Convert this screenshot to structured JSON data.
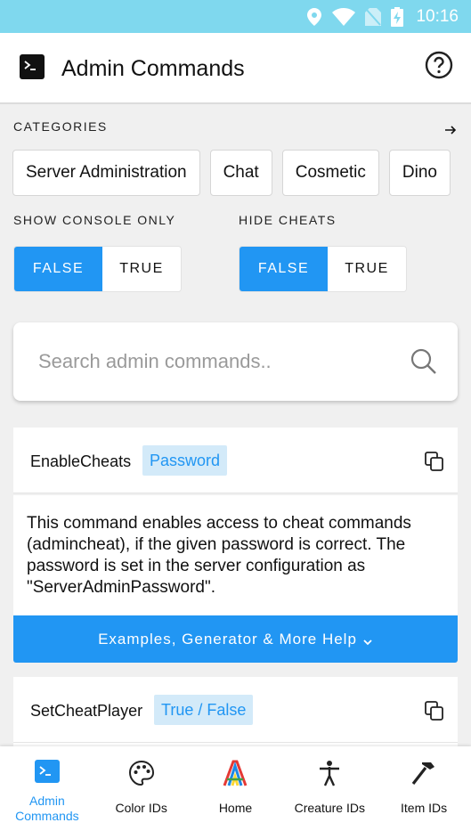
{
  "status_bar": {
    "time": "10:16"
  },
  "app_bar": {
    "title": "Admin Commands"
  },
  "categories": {
    "label": "CATEGORIES",
    "chips": [
      "Server Administration",
      "Chat",
      "Cosmetic",
      "Dino"
    ]
  },
  "show_console_only": {
    "label": "SHOW CONSOLE ONLY",
    "options": [
      "FALSE",
      "TRUE"
    ],
    "selected": "FALSE"
  },
  "hide_cheats": {
    "label": "HIDE CHEATS",
    "options": [
      "FALSE",
      "TRUE"
    ],
    "selected": "FALSE"
  },
  "search": {
    "placeholder": "Search admin commands..",
    "value": ""
  },
  "commands": [
    {
      "name": "EnableCheats",
      "param": "Password",
      "description": "This command enables access to cheat commands (admincheat), if the given password is correct. The password is set in the server configuration as \"ServerAdminPassword\".",
      "help_label": "Examples, Generator & More Help"
    },
    {
      "name": "SetCheatPlayer",
      "param": "True / False"
    }
  ],
  "bottom_nav": [
    {
      "label": "Admin\nCommands",
      "icon": "terminal-icon",
      "active": true
    },
    {
      "label": "Color IDs",
      "icon": "palette-icon",
      "active": false
    },
    {
      "label": "Home",
      "icon": "home-logo-icon",
      "active": false
    },
    {
      "label": "Creature IDs",
      "icon": "creature-icon",
      "active": false
    },
    {
      "label": "Item IDs",
      "icon": "hammer-icon",
      "active": false
    }
  ],
  "colors": {
    "accent": "#2196f3",
    "status_bar": "#7fd8ee",
    "badge_bg": "#d3eaf9"
  }
}
